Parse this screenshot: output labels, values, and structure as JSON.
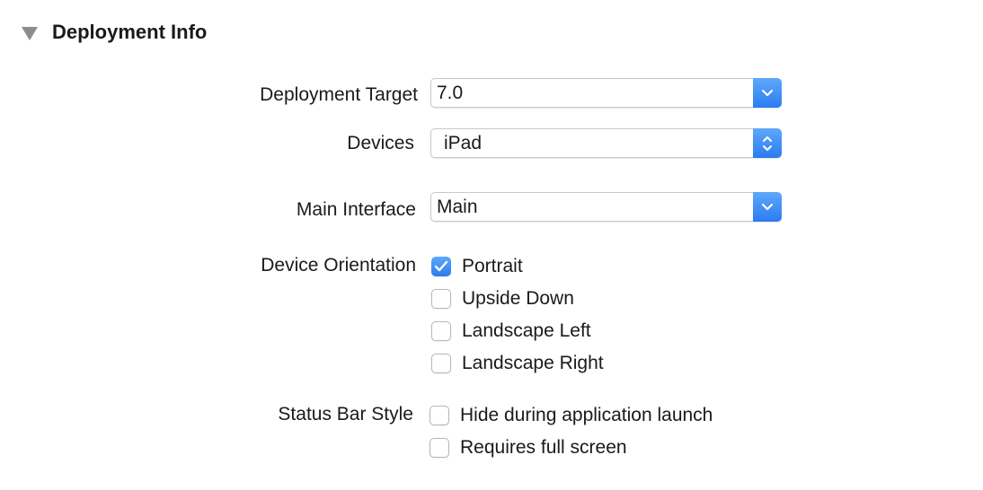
{
  "section": {
    "title": "Deployment Info"
  },
  "deployment_target": {
    "label": "Deployment Target",
    "value": "7.0"
  },
  "devices": {
    "label": "Devices",
    "value": "iPad"
  },
  "main_interface": {
    "label": "Main Interface",
    "value": "Main"
  },
  "device_orientation": {
    "label": "Device Orientation",
    "options": [
      {
        "label": "Portrait",
        "checked": true
      },
      {
        "label": "Upside Down",
        "checked": false
      },
      {
        "label": "Landscape Left",
        "checked": false
      },
      {
        "label": "Landscape Right",
        "checked": false
      }
    ]
  },
  "status_bar_style": {
    "label": "Status Bar Style",
    "options": [
      {
        "label": "Hide during application launch",
        "checked": false
      },
      {
        "label": "Requires full screen",
        "checked": false
      }
    ]
  },
  "colors": {
    "accent": "#2b7cf0",
    "disclosure": "#8c8c8c"
  },
  "icons": {
    "disclosure": "disclosure-triangle-icon",
    "popup_arrow": "chevron-down-icon",
    "stepper_arrow": "chevron-up-down-icon",
    "check": "checkmark-icon"
  }
}
